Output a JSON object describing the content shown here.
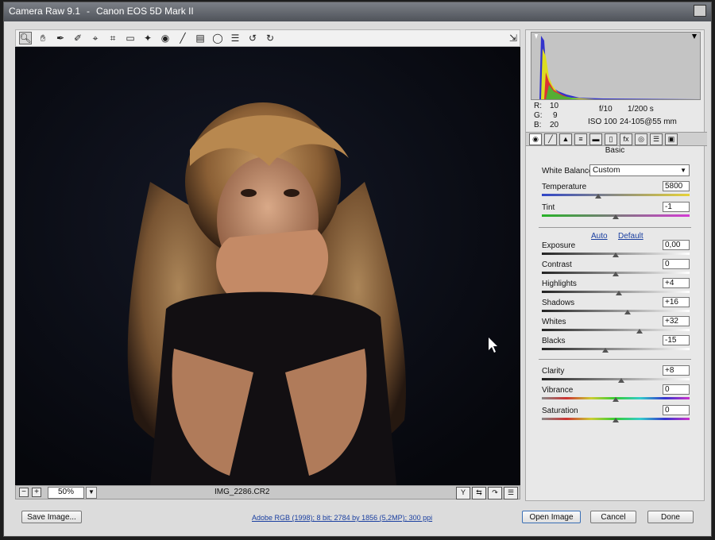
{
  "window": {
    "title_app": "Camera Raw 9.1",
    "title_sep": "-",
    "title_camera": "Canon EOS 5D Mark II"
  },
  "toolbar": {
    "tools": [
      "zoom-icon",
      "hand-icon",
      "white-balance-icon",
      "color-sampler-icon",
      "target-adjust-icon",
      "crop-icon",
      "straighten-icon",
      "spot-removal-icon",
      "red-eye-icon",
      "adjustment-brush-icon",
      "graduated-filter-icon",
      "radial-filter-icon",
      "preferences-icon",
      "rotate-left-icon",
      "rotate-right-icon"
    ],
    "active_tool": "zoom-icon"
  },
  "status": {
    "zoom": "50%",
    "filename": "IMG_2286.CR2"
  },
  "info": {
    "r_label": "R:",
    "r": "10",
    "g_label": "G:",
    "g": "9",
    "b_label": "B:",
    "b": "20",
    "aperture": "f/10",
    "shutter": "1/200 s",
    "iso": "ISO 100",
    "lens": "24-105@55 mm"
  },
  "panel": {
    "title": "Basic",
    "wb_label": "White Balance:",
    "wb_value": "Custom",
    "auto": "Auto",
    "default": "Default",
    "temperature": {
      "label": "Temperature",
      "value": "5800",
      "level": 0.38
    },
    "tint": {
      "label": "Tint",
      "value": "-1",
      "level": 0.5
    },
    "exposure": {
      "label": "Exposure",
      "value": "0,00",
      "level": 0.5
    },
    "contrast": {
      "label": "Contrast",
      "value": "0",
      "level": 0.5
    },
    "highlights": {
      "label": "Highlights",
      "value": "+4",
      "level": 0.52
    },
    "shadows": {
      "label": "Shadows",
      "value": "+16",
      "level": 0.58
    },
    "whites": {
      "label": "Whites",
      "value": "+32",
      "level": 0.66
    },
    "blacks": {
      "label": "Blacks",
      "value": "-15",
      "level": 0.43
    },
    "clarity": {
      "label": "Clarity",
      "value": "+8",
      "level": 0.54
    },
    "vibrance": {
      "label": "Vibrance",
      "value": "0",
      "level": 0.5
    },
    "saturation": {
      "label": "Saturation",
      "value": "0",
      "level": 0.5
    }
  },
  "footer": {
    "save": "Save Image...",
    "workflow": "Adobe RGB (1998); 8 bit; 2784 by 1856 (5,2MP); 300 ppi",
    "open": "Open Image",
    "cancel": "Cancel",
    "done": "Done"
  },
  "colors": {
    "link": "#1a3fa0",
    "temperature_gradient": [
      "#3046c8",
      "#e6d238"
    ],
    "tint_gradient": [
      "#27b327",
      "#d43cd4"
    ]
  }
}
